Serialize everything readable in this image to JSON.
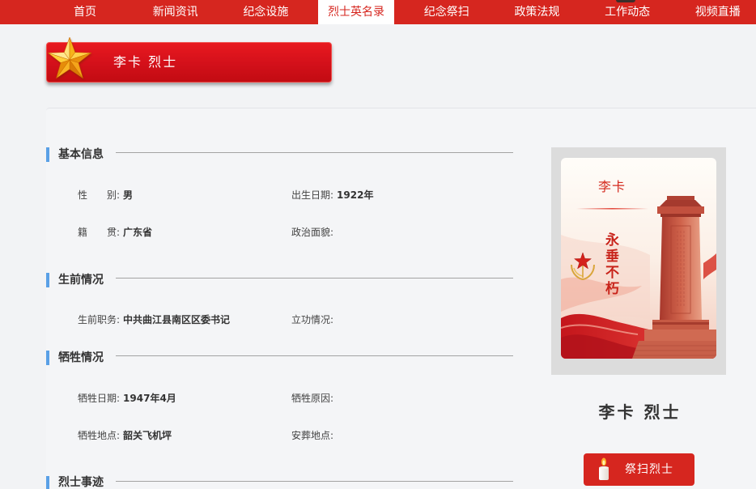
{
  "nav": {
    "items": [
      {
        "label": "首页",
        "active": false
      },
      {
        "label": "新闻资讯",
        "active": false
      },
      {
        "label": "纪念设施",
        "active": false
      },
      {
        "label": "烈士英名录",
        "active": true
      },
      {
        "label": "纪念祭扫",
        "active": false
      },
      {
        "label": "政策法规",
        "active": false
      },
      {
        "label": "工作动态",
        "active": false
      },
      {
        "label": "视频直播",
        "active": false
      }
    ]
  },
  "banner": {
    "title": "李卡 烈士",
    "icon": "star-icon"
  },
  "sections": [
    {
      "title": "基本信息",
      "fields": [
        {
          "label": "性　　别:",
          "value": "男"
        },
        {
          "label": "出生日期:",
          "value": "1922年"
        },
        {
          "label": "籍　　贯:",
          "value": "广东省"
        },
        {
          "label": "政治面貌:",
          "value": ""
        }
      ]
    },
    {
      "title": "生前情况",
      "fields": [
        {
          "label": "生前职务:",
          "value": "中共曲江县南区区委书记"
        },
        {
          "label": "立功情况:",
          "value": ""
        }
      ]
    },
    {
      "title": "牺牲情况",
      "fields": [
        {
          "label": "牺牲日期:",
          "value": "1947年4月"
        },
        {
          "label": "牺牲原因:",
          "value": ""
        },
        {
          "label": "牺牲地点:",
          "value": "韶关飞机坪"
        },
        {
          "label": "安葬地点:",
          "value": ""
        }
      ]
    },
    {
      "title": "烈士事迹",
      "fields": []
    }
  ],
  "portrait": {
    "name": "李卡",
    "motto": "永垂不朽",
    "emblem_icon": "star-emblem-icon",
    "monument_icon": "monument-icon"
  },
  "profile": {
    "name": "李卡 烈士"
  },
  "memorial_button": {
    "label": "祭扫烈士",
    "icon": "candle-icon"
  },
  "colors": {
    "nav_red": "#d6261f",
    "banner_red": "#d3101a",
    "section_accent": "#5aa0e6",
    "star_gold": "#ffcc33",
    "text": "#333333"
  }
}
